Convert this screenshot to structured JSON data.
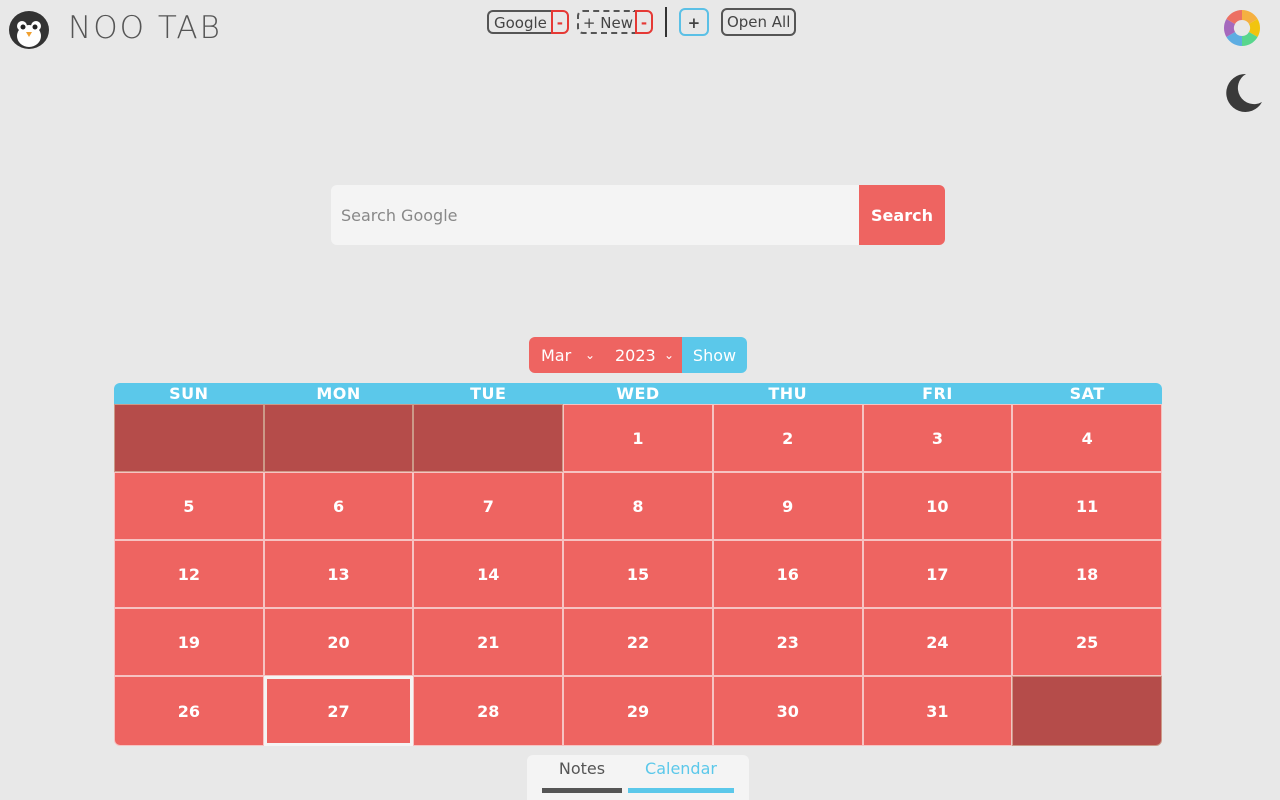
{
  "app": {
    "title": "NOO TAB"
  },
  "bookmarks": {
    "google_label": "Google",
    "delete_label": "-",
    "new_label": "+ New",
    "add_label": "+",
    "open_all_label": "Open All"
  },
  "search": {
    "placeholder": "Search Google",
    "button_label": "Search"
  },
  "picker": {
    "month": "Mar",
    "year": "2023",
    "show_label": "Show"
  },
  "calendar": {
    "weekdays": [
      "SUN",
      "MON",
      "TUE",
      "WED",
      "THU",
      "FRI",
      "SAT"
    ],
    "days": [
      "",
      "",
      "",
      "1",
      "2",
      "3",
      "4",
      "5",
      "6",
      "7",
      "8",
      "9",
      "10",
      "11",
      "12",
      "13",
      "14",
      "15",
      "16",
      "17",
      "18",
      "19",
      "20",
      "21",
      "22",
      "23",
      "24",
      "25",
      "26",
      "27",
      "28",
      "29",
      "30",
      "31",
      ""
    ],
    "today": "27"
  },
  "tabs": {
    "notes_label": "Notes",
    "calendar_label": "Calendar",
    "active": "Calendar"
  },
  "colors": {
    "accent_red": "#ee6461",
    "accent_blue": "#5bc8ea",
    "dim_red": "#b54c4a",
    "background": "#e8e8e8"
  },
  "icons": {
    "logo": "penguin-icon",
    "theme": "color-wheel-icon",
    "dark_mode": "moon-icon"
  }
}
